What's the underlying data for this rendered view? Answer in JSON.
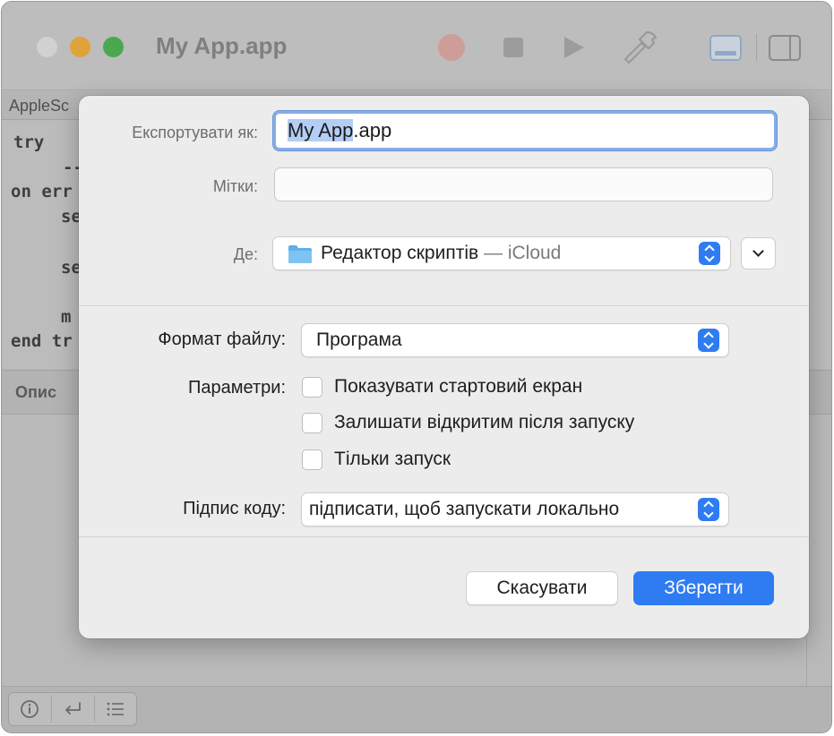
{
  "window": {
    "title": "My App.app",
    "language_label": "AppleSc",
    "code_lines": [
      "try",
      "--",
      "on err",
      "se",
      "se",
      "m",
      "end tr"
    ],
    "description_label": "Опис"
  },
  "export": {
    "name_label": "Експортувати як:",
    "name_selected": "My App",
    "name_extension": ".app",
    "tags_label": "Мітки:",
    "tags_value": "",
    "where_label": "Де:",
    "where_folder": "Редактор скриптів",
    "where_location": " — iCloud",
    "format_label": "Формат файлу:",
    "format_value": "Програма",
    "options_label": "Параметри:",
    "options": [
      {
        "label": "Показувати стартовий екран",
        "checked": false
      },
      {
        "label": "Залишати відкритим після запуску",
        "checked": false
      },
      {
        "label": "Тільки запуск",
        "checked": false
      }
    ],
    "signing_label": "Підпис коду:",
    "signing_value": "підписати, щоб запускати локально",
    "cancel_label": "Скасувати",
    "save_label": "Зберегти"
  },
  "colors": {
    "accent": "#2f7cf2",
    "focus_ring": "#86aee6",
    "selection": "#b4cdf4",
    "sheet_bg": "#ececec"
  },
  "icons": {
    "toolbar": [
      "record-icon",
      "stop-icon",
      "run-icon",
      "compile-hammer-icon",
      "bottom-panel-icon",
      "side-panel-icon"
    ],
    "bottom_bar": [
      "info-icon",
      "reply-arrow-icon",
      "list-icon"
    ],
    "where": "folder-icon"
  }
}
